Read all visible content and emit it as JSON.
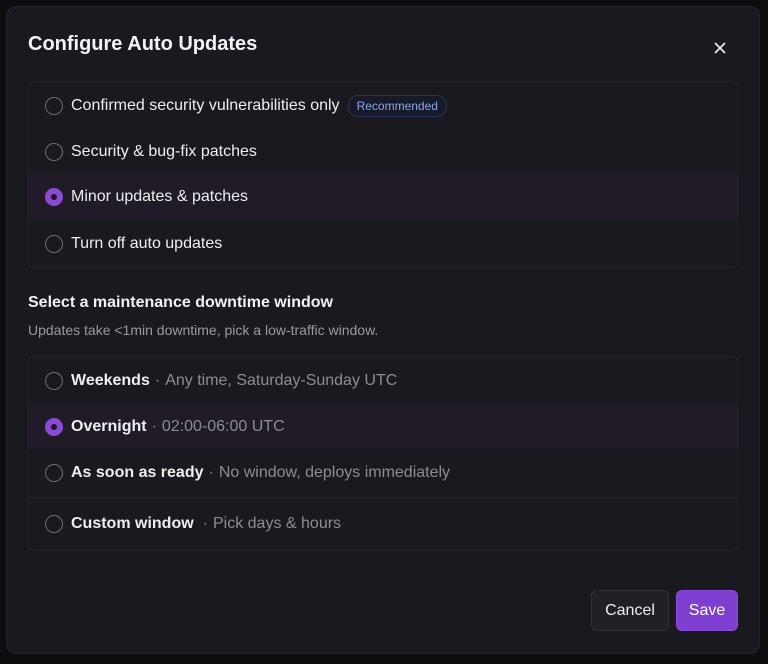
{
  "dialog": {
    "title": "Configure Auto Updates",
    "close_icon": "close-icon"
  },
  "update_policy": {
    "options": [
      {
        "label": "Confirmed security vulnerabilities only",
        "badge": "Recommended",
        "selected": false
      },
      {
        "label": "Security & bug-fix patches",
        "selected": false
      },
      {
        "label": "Minor updates & patches",
        "selected": true
      },
      {
        "label": "Turn off auto updates",
        "selected": false
      }
    ]
  },
  "maintenance": {
    "title": "Select a maintenance downtime window",
    "subtitle": "Updates take <1min downtime, pick a low-traffic window.",
    "separator": "·",
    "options": [
      {
        "label": "Weekends",
        "desc": "Any time, Saturday-Sunday UTC",
        "selected": false
      },
      {
        "label": "Overnight",
        "desc": "02:00-06:00 UTC",
        "selected": true
      },
      {
        "label": "As soon as ready",
        "desc": "No window, deploys immediately",
        "selected": false
      },
      {
        "label": "Custom window",
        "desc": "Pick days & hours",
        "selected": false
      }
    ]
  },
  "footer": {
    "cancel_label": "Cancel",
    "save_label": "Save"
  },
  "colors": {
    "accent": "#8a49d6",
    "background": "#1a191f",
    "badge_text": "#8aa6e8"
  }
}
